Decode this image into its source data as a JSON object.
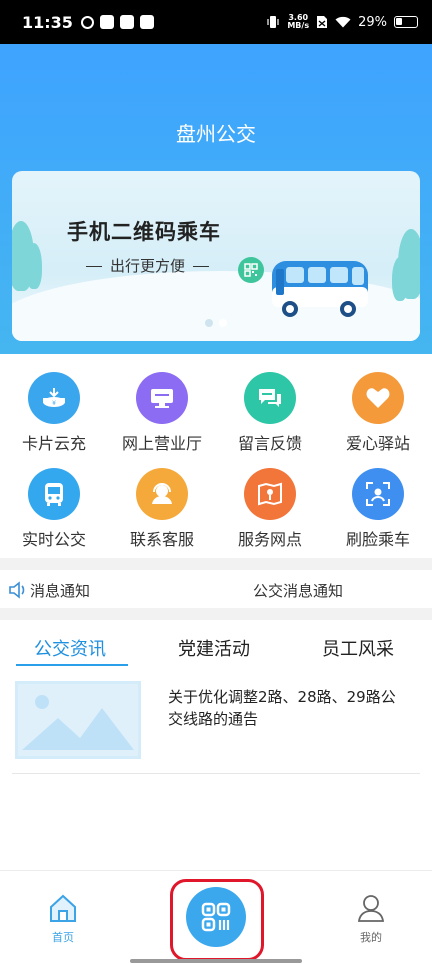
{
  "status_bar": {
    "time": "11:35",
    "net_speed_value": "3.60",
    "net_speed_unit": "MB/s",
    "battery": "29%"
  },
  "header": {
    "title": "盘州公交"
  },
  "banner": {
    "headline": "手机二维码乘车",
    "subline": "出行更方便",
    "active_slide": 1,
    "slide_count": 2
  },
  "services": [
    {
      "label": "卡片云充",
      "icon": "card-recharge-icon",
      "color": "#3aa6ee"
    },
    {
      "label": "网上营业厅",
      "icon": "online-hall-icon",
      "color": "#8b6cf2"
    },
    {
      "label": "留言反馈",
      "icon": "feedback-icon",
      "color": "#2dc6a6"
    },
    {
      "label": "爱心驿站",
      "icon": "heart-icon",
      "color": "#f59a3a"
    },
    {
      "label": "实时公交",
      "icon": "bus-icon",
      "color": "#34a8ee"
    },
    {
      "label": "联系客服",
      "icon": "customer-service-icon",
      "color": "#f5a93b"
    },
    {
      "label": "服务网点",
      "icon": "map-icon",
      "color": "#f2753a"
    },
    {
      "label": "刷脸乘车",
      "icon": "face-scan-icon",
      "color": "#3f8ff1"
    }
  ],
  "notice": {
    "left_text": "消息通知",
    "right_text": "公交消息通知"
  },
  "tabs": [
    {
      "label": "公交资讯",
      "active": true
    },
    {
      "label": "党建活动",
      "active": false
    },
    {
      "label": "员工风采",
      "active": false
    }
  ],
  "news": [
    {
      "title": "关于优化调整2路、28路、29路公交线路的通告"
    }
  ],
  "bottom_nav": {
    "home_label": "首页",
    "mine_label": "我的",
    "accent": "#3ba3e6",
    "highlight_color": "#e0162b"
  }
}
